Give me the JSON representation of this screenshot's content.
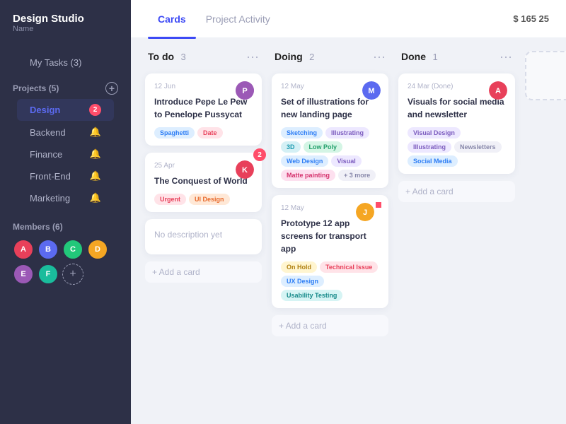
{
  "sidebar": {
    "brand": "Design Studio",
    "brand_sub": "Name",
    "my_tasks": "My Tasks (3)",
    "projects_label": "Projects (5)",
    "members_label": "Members (6)",
    "projects": [
      {
        "label": "Design",
        "active": true,
        "badge": 2
      },
      {
        "label": "Backend",
        "bell": true
      },
      {
        "label": "Finance",
        "bell": true
      },
      {
        "label": "Front-End",
        "bell": false
      },
      {
        "label": "Marketing",
        "bell": false
      }
    ],
    "members": [
      {
        "color": "#e8405a",
        "initials": "A"
      },
      {
        "color": "#5b6af0",
        "initials": "B"
      },
      {
        "color": "#22c87a",
        "initials": "C"
      },
      {
        "color": "#f5a623",
        "initials": "D"
      },
      {
        "color": "#9b59b6",
        "initials": "E"
      },
      {
        "color": "#1abc9c",
        "initials": "F"
      }
    ]
  },
  "topbar": {
    "tab_cards": "Cards",
    "tab_activity": "Project Activity",
    "budget": "$ 165 25"
  },
  "board": {
    "columns": [
      {
        "id": "todo",
        "title": "To do",
        "count": "3",
        "cards": [
          {
            "date": "12 Jun",
            "title": "Introduce Pepe Le Pew to Penelope Pussycat",
            "avatar_color": "#9b59b6",
            "tags": [
              {
                "label": "Spaghetti",
                "style": "blue"
              },
              {
                "label": "Date",
                "style": "red"
              }
            ]
          },
          {
            "date": "25 Apr",
            "title": "The Conquest of World",
            "avatar_color": "#e8405a",
            "badge": 2,
            "tags": [
              {
                "label": "Urgent",
                "style": "red"
              },
              {
                "label": "UI Design",
                "style": "orange"
              }
            ]
          },
          {
            "date": "",
            "title": "No description yet",
            "avatar_color": null,
            "tags": []
          }
        ],
        "add_label": "Add a card"
      },
      {
        "id": "doing",
        "title": "Doing",
        "count": "2",
        "cards": [
          {
            "date": "12 May",
            "title": "Set of illustrations for new landing page",
            "avatar_color": "#5b6af0",
            "tags": [
              {
                "label": "Sketching",
                "style": "blue"
              },
              {
                "label": "Illustrating",
                "style": "purple"
              },
              {
                "label": "3D",
                "style": "teal"
              },
              {
                "label": "Low Poly",
                "style": "green"
              },
              {
                "label": "Web Design",
                "style": "blue"
              },
              {
                "label": "Visual",
                "style": "purple"
              },
              {
                "label": "Matte painting",
                "style": "pink"
              },
              {
                "label": "+ 3 more",
                "style": "gray"
              }
            ]
          },
          {
            "date": "12 May",
            "title": "Prototype 12 app screens for transport app",
            "avatar_color": "#f5a623",
            "badge_dot": true,
            "tags": [
              {
                "label": "On Hold",
                "style": "yellow"
              },
              {
                "label": "Technical Issue",
                "style": "red"
              },
              {
                "label": "UX Design",
                "style": "blue"
              },
              {
                "label": "Usability Testing",
                "style": "teal"
              }
            ]
          }
        ],
        "add_label": "Add a card"
      },
      {
        "id": "done",
        "title": "Done",
        "count": "1",
        "cards": [
          {
            "date": "24 Mar (Done)",
            "title": "Visuals for social media and newsletter",
            "avatar_color": "#e8405a",
            "tags": [
              {
                "label": "Visual Design",
                "style": "purple"
              },
              {
                "label": "Illustrating",
                "style": "purple"
              },
              {
                "label": "Newsletters",
                "style": "gray"
              },
              {
                "label": "Social Media",
                "style": "blue"
              }
            ]
          }
        ],
        "add_label": "Add a card"
      }
    ],
    "add_column_icon": "+"
  }
}
